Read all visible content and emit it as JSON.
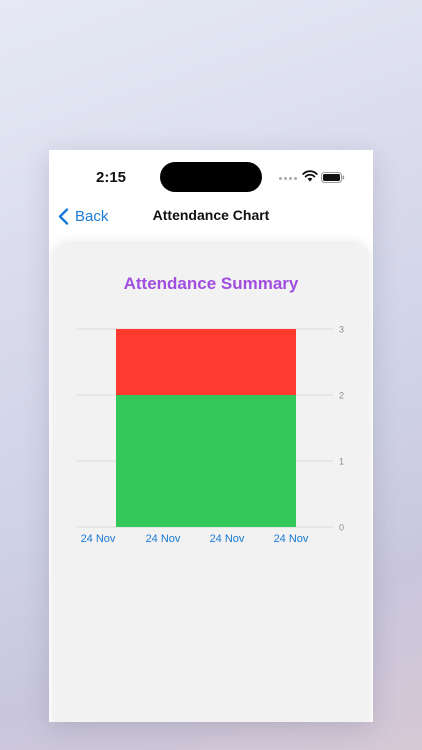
{
  "status_bar": {
    "time": "2:15"
  },
  "nav": {
    "back_label": "Back",
    "title": "Attendance Chart"
  },
  "card": {
    "title": "Attendance Summary"
  },
  "chart_data": {
    "type": "bar",
    "stacked": true,
    "categories": [
      "24 Nov"
    ],
    "x_tick_labels": [
      "24 Nov",
      "24 Nov",
      "24 Nov",
      "24 Nov"
    ],
    "series": [
      {
        "values": [
          2
        ],
        "color": "#34c759"
      },
      {
        "values": [
          1
        ],
        "color": "#ff3b30"
      }
    ],
    "ylim": [
      0,
      3
    ],
    "y_ticks": [
      0,
      1,
      2,
      3
    ],
    "y_axis_side": "right",
    "grid": true,
    "title": "Attendance Summary"
  },
  "colors": {
    "accent": "#1a7ad6",
    "title_purple": "#a14ee0"
  }
}
